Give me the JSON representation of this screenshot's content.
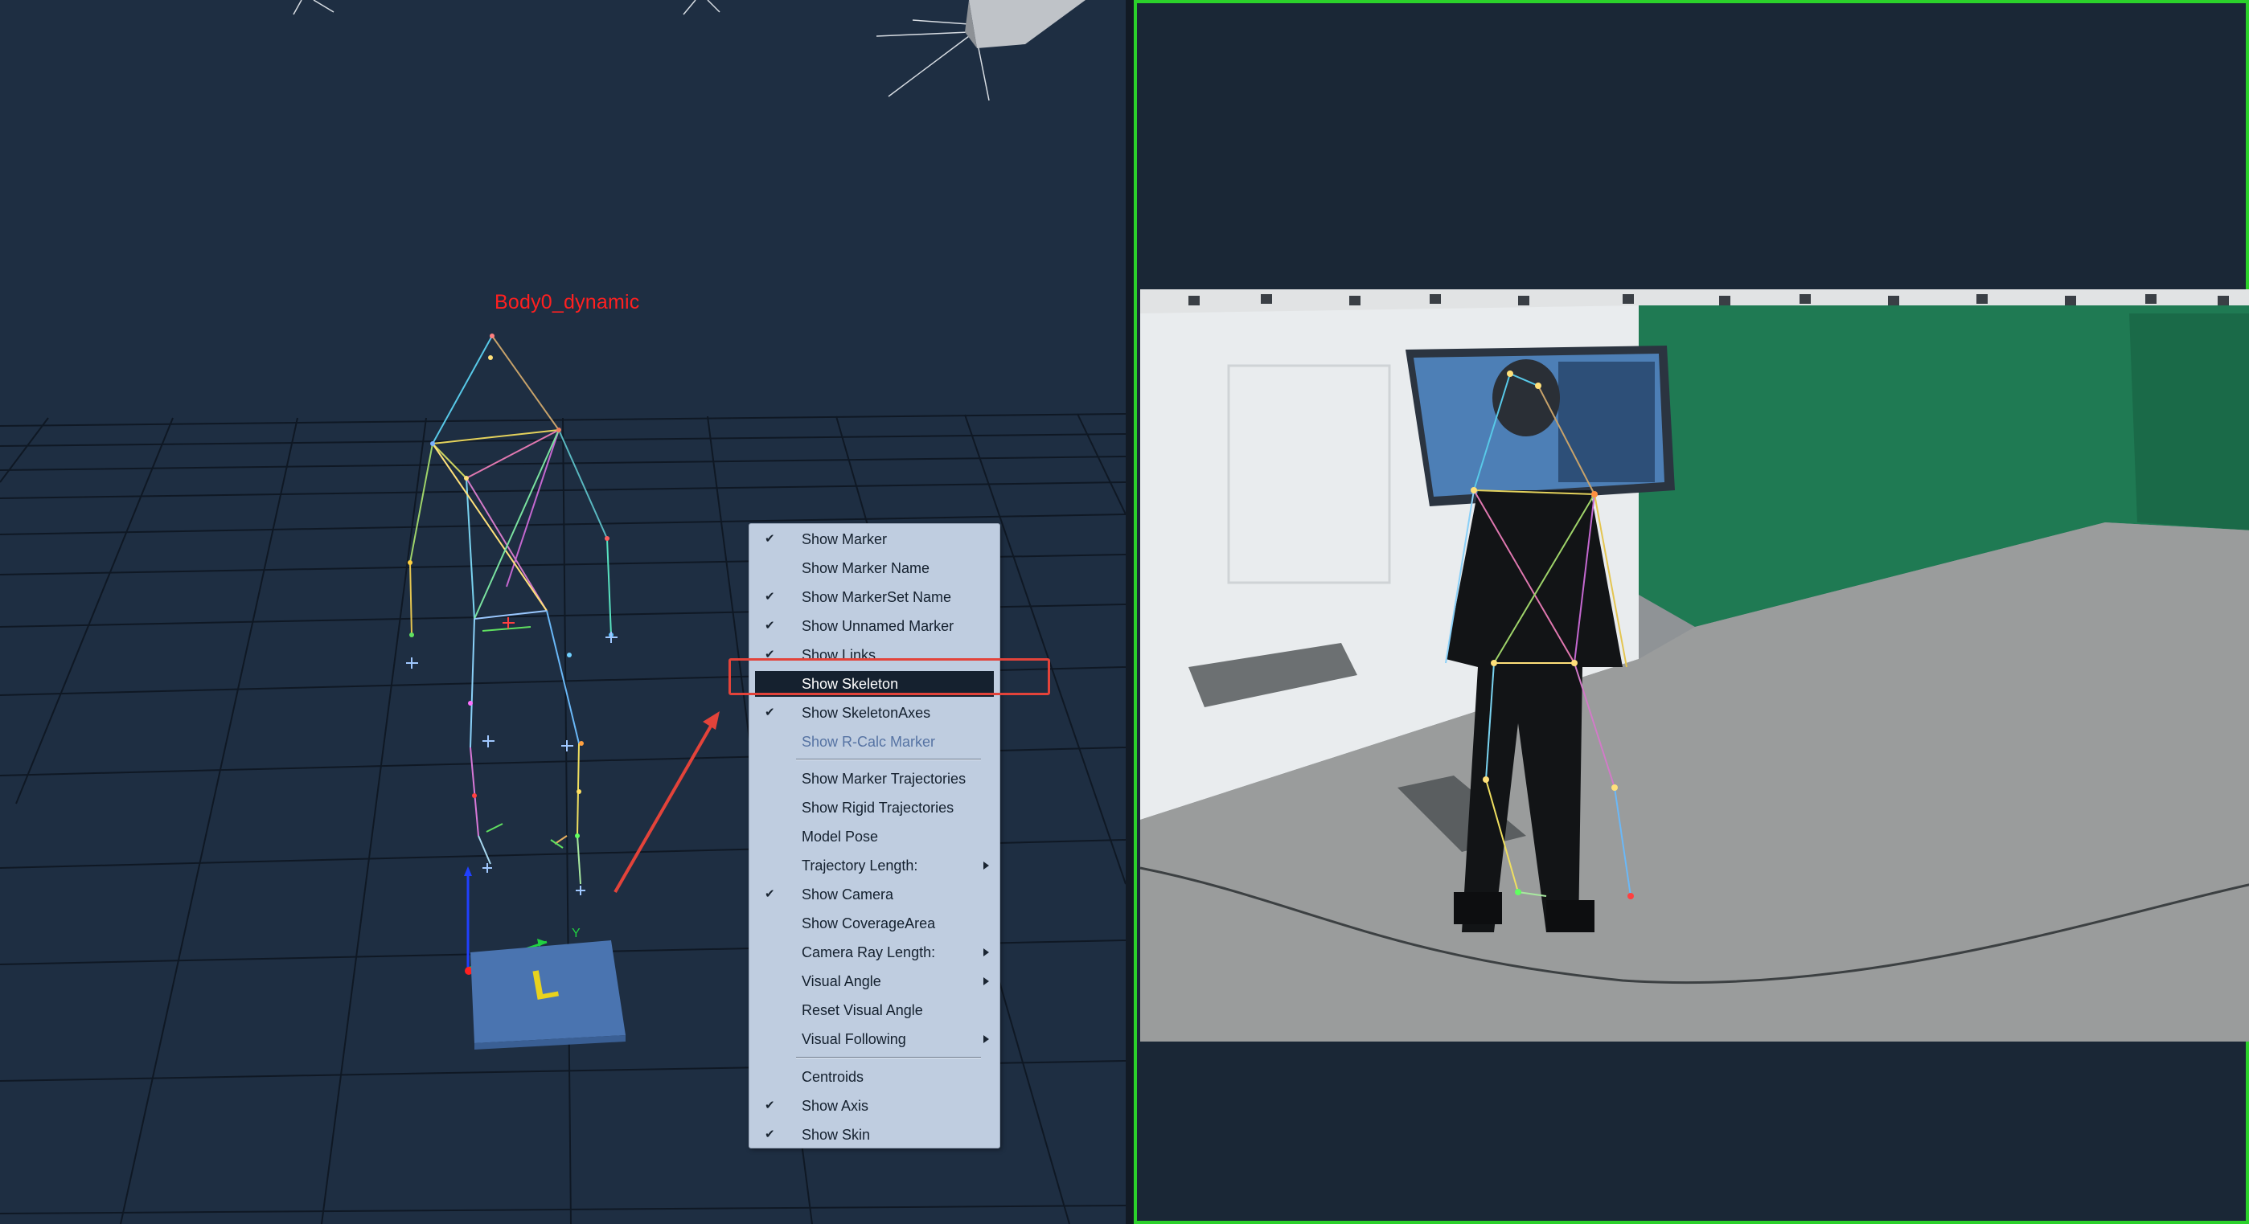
{
  "scene": {
    "body_label": "Body0_dynamic",
    "axis_y_label": "Y",
    "plate_letter": "L",
    "colors": {
      "background": "#1e2e42",
      "grid": "#0f1824",
      "label_red": "#ff2020",
      "plate": "#4a74b0",
      "plate_letter": "#e8d21d"
    }
  },
  "context_menu": {
    "items": [
      {
        "label": "Show Marker",
        "checked": true
      },
      {
        "label": "Show Marker Name",
        "checked": false
      },
      {
        "label": "Show MarkerSet Name",
        "checked": true
      },
      {
        "label": "Show Unnamed Marker",
        "checked": true
      },
      {
        "label": "Show Links",
        "checked": true
      },
      {
        "label": "Show Skeleton",
        "checked": false,
        "highlighted": true
      },
      {
        "label": "Show SkeletonAxes",
        "checked": true
      },
      {
        "label": "Show R-Calc Marker",
        "checked": false,
        "disabled": true
      },
      {
        "label": "Show Marker Trajectories",
        "checked": false
      },
      {
        "label": "Show Rigid Trajectories",
        "checked": false
      },
      {
        "label": "Model Pose",
        "checked": false
      },
      {
        "label": "Trajectory Length:",
        "checked": false,
        "submenu": true
      },
      {
        "label": "Show Camera",
        "checked": true
      },
      {
        "label": "Show CoverageArea",
        "checked": false
      },
      {
        "label": "Camera Ray Length:",
        "checked": false,
        "submenu": true
      },
      {
        "label": "Visual Angle",
        "checked": false,
        "submenu": true
      },
      {
        "label": "Reset Visual Angle",
        "checked": false
      },
      {
        "label": "Visual Following",
        "checked": false,
        "submenu": true
      },
      {
        "label": "Centroids",
        "checked": false
      },
      {
        "label": "Show Axis",
        "checked": true
      },
      {
        "label": "Show Skin",
        "checked": true
      }
    ],
    "check_glyph": "✔"
  },
  "camera_view": {
    "border_color": "#2bd12b",
    "wall_color": "#e9ecee",
    "green_screen": "#1f7a53",
    "floor_color": "#9a9c9c"
  }
}
